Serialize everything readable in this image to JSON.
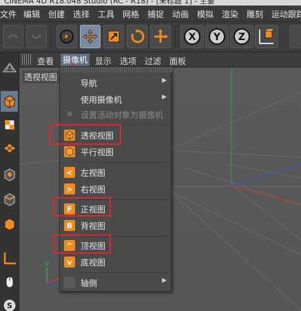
{
  "window": {
    "title": "CINEMA 4D R18.048 Studio (RC - R18) - [未标题 1] - 主要"
  },
  "menubar": {
    "items": [
      "文件",
      "编辑",
      "创建",
      "选择",
      "工具",
      "网格",
      "捕捉",
      "动画",
      "模拟",
      "渲染",
      "雕刻",
      "运动跟踪"
    ]
  },
  "toolbar": {
    "icons": [
      "undo-icon",
      "redo-icon",
      "live-select-icon",
      "move-icon",
      "scale-icon",
      "rotate-icon",
      "coordinate-icon",
      "x-axis-icon",
      "y-axis-icon",
      "z-axis-icon",
      "coordinate-system-icon"
    ]
  },
  "viewport_menu": {
    "items": [
      "查看",
      "摄像机",
      "显示",
      "选项",
      "过滤",
      "面板"
    ],
    "selected": "摄像机"
  },
  "viewport": {
    "label": "透视视图",
    "axis_y_label": "Y"
  },
  "camera_menu": {
    "items": [
      {
        "label": "导航",
        "submenu": true
      },
      {
        "label": "使用摄像机",
        "submenu": true
      },
      {
        "label": "设置活动对象为摄像机",
        "disabled": true
      },
      {
        "label": "透视视图",
        "highlighted": true
      },
      {
        "label": "平行视图"
      },
      {
        "label": "左视图",
        "icon_letter": "<"
      },
      {
        "label": "右视图",
        "icon_letter": ">"
      },
      {
        "label": "正视图",
        "icon_letter": "F",
        "highlighted": true
      },
      {
        "label": "背视图",
        "icon_letter": "B"
      },
      {
        "label": "顶视图",
        "icon_letter": "^",
        "highlighted": true
      },
      {
        "label": "底视图",
        "icon_letter": "v"
      },
      {
        "label": "轴侧",
        "submenu": true
      }
    ]
  },
  "colors": {
    "accent": "#f08c1e",
    "highlight_box": "#e0262c",
    "selected_menu": "#5f6e85",
    "arrow": "#e0262c"
  }
}
